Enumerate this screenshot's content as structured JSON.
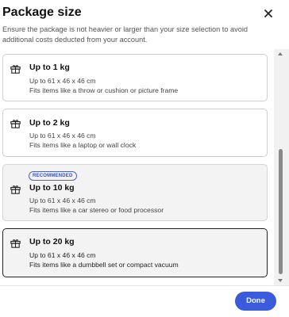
{
  "dialog": {
    "title": "Package size",
    "subtitle": "Ensure the package is not heavier or larger than your size selection to avoid additional costs deducted from your account."
  },
  "options": [
    {
      "label": "Up to 1 kg",
      "dimensions": "Up to 61 x 46 x 46 cm",
      "fits": "Fits items like a throw or cushion or picture frame"
    },
    {
      "label": "Up to 2 kg",
      "dimensions": "Up to 61 x 46 x 46 cm",
      "fits": "Fits items like a laptop or wall clock"
    },
    {
      "label": "Up to 10 kg",
      "badge": "RECOMMENDED",
      "dimensions": "Up to 61 x 46 x 46 cm",
      "fits": "Fits items like a car stereo or food processor"
    },
    {
      "label": "Up to 20 kg",
      "dimensions": "Up to 61 x 46 x 46 cm",
      "fits": "Fits items like a dumbbell set or compact vacuum",
      "selected": true
    }
  ],
  "footer": {
    "done_label": "Done"
  },
  "colors": {
    "accent": "#3a5bdc",
    "badge": "#4a63c9",
    "selected_border": "#222222"
  },
  "icons": {
    "option": "gift-icon",
    "close": "close-icon"
  }
}
